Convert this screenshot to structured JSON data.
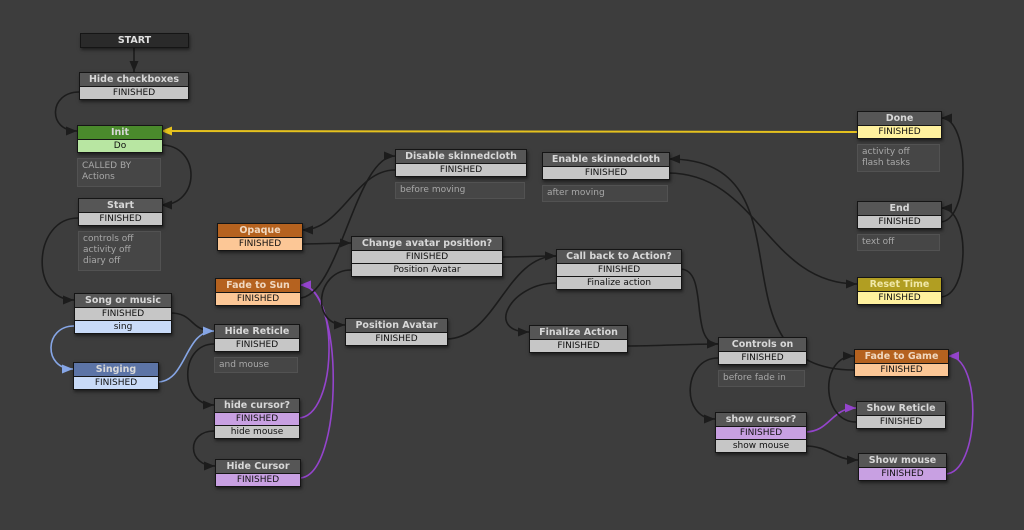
{
  "colors": {
    "background": "#3d3d3d",
    "edge_default": "#1c1c1c",
    "edge_global": "#e6c21e",
    "edge_blue": "#86a6e6",
    "edge_purple": "#9444cc"
  },
  "styles": {
    "start": {
      "title_bg": "#2a2a2a",
      "title_fg": "#e0e0e0"
    },
    "gray": {
      "title_bg": "#565656",
      "row_bg": "#c6c6c6"
    },
    "green": {
      "title_bg": "#4a8a2c",
      "row_bg": "#b8e6a2"
    },
    "orange": {
      "title_bg": "#b5621f",
      "row_bg": "#fcc796",
      "title_fg": "#f0d8c0"
    },
    "yellow": {
      "title_bg": "#b19e22",
      "row_bg": "#fff19e",
      "title_fg": "#f0e8a8"
    },
    "blue": {
      "title_bg": "#5c74a6",
      "row_bg": "#c9dbf8"
    },
    "purple": {
      "row_bg": "#c8a0e2"
    }
  },
  "nodes": [
    {
      "id": "start",
      "title": "START",
      "style": "start",
      "rows": []
    },
    {
      "id": "hide-checkboxes",
      "title": "Hide checkboxes",
      "style": "gray",
      "rows": [
        {
          "label": "FINISHED"
        }
      ]
    },
    {
      "id": "init",
      "title": "Init",
      "style": "green",
      "rows": [
        {
          "label": "Do"
        }
      ],
      "comment": "CALLED BY\nActions"
    },
    {
      "id": "start-state",
      "title": "Start",
      "style": "gray",
      "rows": [
        {
          "label": "FINISHED"
        }
      ],
      "comment": "controls off\nactivity off\ndiary off"
    },
    {
      "id": "song-or-music",
      "title": "Song or music",
      "style": "gray",
      "rows": [
        {
          "label": "FINISHED"
        },
        {
          "label": "sing",
          "style": "blue"
        }
      ]
    },
    {
      "id": "singing",
      "title": "Singing",
      "style": "blue",
      "rows": [
        {
          "label": "FINISHED"
        }
      ]
    },
    {
      "id": "hide-reticle",
      "title": "Hide Reticle",
      "style": "gray",
      "rows": [
        {
          "label": "FINISHED"
        }
      ],
      "comment": "and mouse"
    },
    {
      "id": "hide-cursor-q",
      "title": "hide cursor?",
      "style": "gray",
      "rows": [
        {
          "label": "FINISHED",
          "style": "purple"
        },
        {
          "label": "hide mouse"
        }
      ]
    },
    {
      "id": "hide-cursor",
      "title": "Hide Cursor",
      "style": "gray",
      "rows": [
        {
          "label": "FINISHED",
          "style": "purple"
        }
      ]
    },
    {
      "id": "opaque",
      "title": "Opaque",
      "style": "orange",
      "rows": [
        {
          "label": "FINISHED"
        }
      ]
    },
    {
      "id": "fade-to-sun",
      "title": "Fade to Sun",
      "style": "orange",
      "rows": [
        {
          "label": "FINISHED"
        }
      ]
    },
    {
      "id": "disable-skinnedcloth",
      "title": "Disable skinnedcloth",
      "style": "gray",
      "rows": [
        {
          "label": "FINISHED"
        }
      ],
      "comment": "before moving"
    },
    {
      "id": "enable-skinnedcloth",
      "title": "Enable skinnedcloth",
      "style": "gray",
      "rows": [
        {
          "label": "FINISHED"
        }
      ],
      "comment": "after moving"
    },
    {
      "id": "change-avatar-position",
      "title": "Change avatar position?",
      "style": "gray",
      "rows": [
        {
          "label": "FINISHED"
        },
        {
          "label": "Position Avatar"
        }
      ]
    },
    {
      "id": "position-avatar",
      "title": "Position Avatar",
      "style": "gray",
      "rows": [
        {
          "label": "FINISHED"
        }
      ]
    },
    {
      "id": "call-back-to-action",
      "title": "Call back to Action?",
      "style": "gray",
      "rows": [
        {
          "label": "FINISHED"
        },
        {
          "label": "Finalize action"
        }
      ]
    },
    {
      "id": "finalize-action",
      "title": "Finalize Action",
      "style": "gray",
      "rows": [
        {
          "label": "FINISHED"
        }
      ]
    },
    {
      "id": "controls-on",
      "title": "Controls on",
      "style": "gray",
      "rows": [
        {
          "label": "FINISHED"
        }
      ],
      "comment": "before fade in"
    },
    {
      "id": "show-cursor-q",
      "title": "show cursor?",
      "style": "gray",
      "rows": [
        {
          "label": "FINISHED",
          "style": "purple"
        },
        {
          "label": "show mouse"
        }
      ]
    },
    {
      "id": "done",
      "title": "Done",
      "style": "yellow-row",
      "rows": [
        {
          "label": "FINISHED"
        }
      ],
      "comment": "activity off\nflash tasks"
    },
    {
      "id": "end",
      "title": "End",
      "style": "gray",
      "rows": [
        {
          "label": "FINISHED"
        }
      ],
      "comment": "text off"
    },
    {
      "id": "reset-time",
      "title": "Reset Time",
      "style": "yellow",
      "rows": [
        {
          "label": "FINISHED"
        }
      ]
    },
    {
      "id": "fade-to-game",
      "title": "Fade to Game",
      "style": "orange",
      "rows": [
        {
          "label": "FINISHED"
        }
      ]
    },
    {
      "id": "show-reticle",
      "title": "Show Reticle",
      "style": "gray",
      "rows": [
        {
          "label": "FINISHED"
        }
      ]
    },
    {
      "id": "show-mouse",
      "title": "Show mouse",
      "style": "gray",
      "rows": [
        {
          "label": "FINISHED",
          "style": "purple"
        }
      ]
    }
  ]
}
